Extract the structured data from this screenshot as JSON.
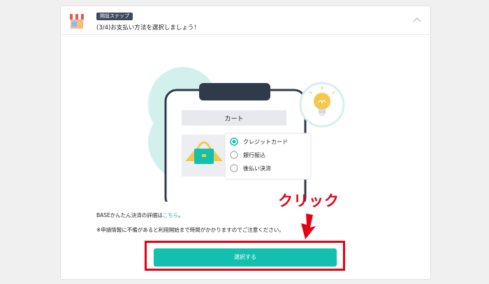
{
  "header": {
    "badge": "開設ステップ",
    "title": "(3/4)お支払い方法を選択しましょう！"
  },
  "illustration": {
    "cart_label": "カート",
    "options": [
      {
        "label": "クレジットカード",
        "selected": true
      },
      {
        "label": "銀行振込",
        "selected": false
      },
      {
        "label": "後払い決済",
        "selected": false
      }
    ]
  },
  "notes": {
    "detail_prefix": "BASEかんたん決済の詳細は",
    "detail_link": "こちら",
    "detail_suffix": "。",
    "caution": "※申請情報に不備があると利用開始まで時間がかかりますのでご注意ください。"
  },
  "button": {
    "label": "選択する"
  },
  "annotation": {
    "label": "クリック"
  },
  "colors": {
    "accent": "#13bfae",
    "link": "#0db5a6",
    "annotation_red": "#e60012",
    "badge_bg": "#3d4a5c",
    "blob": "#d3f1ec",
    "phone_dark": "#2f3a4b"
  }
}
